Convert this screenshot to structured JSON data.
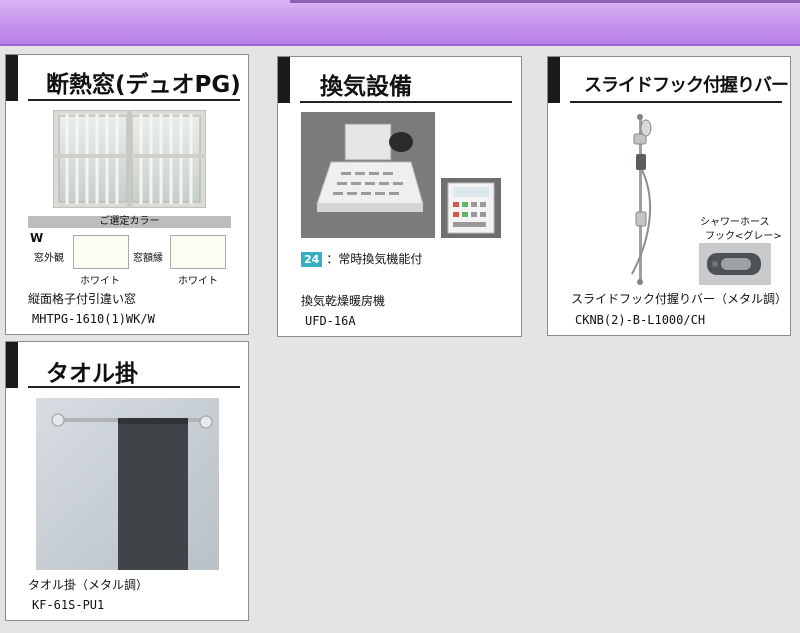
{
  "cards": {
    "window": {
      "title": "断熱窓(デュオPG)",
      "color_header": "ご選定カラー",
      "w_mark": "W",
      "outer_frame_label": "窓外観",
      "outer_frame_color": "ホワイト",
      "frame_label": "窓額縁",
      "frame_color": "ホワイト",
      "product_name": "縦面格子付引違い窓",
      "product_code": "MHTPG-1610(1)WK/W"
    },
    "ventilation": {
      "title": "換気設備",
      "feature_badge": "24",
      "feature_text": "：常時換気機能付",
      "product_name": "換気乾燥暖房機",
      "product_code": "UFD-16A"
    },
    "slide_bar": {
      "title": "スライドフック付握りバー",
      "hose_label_1": "シャワーホース",
      "hose_label_2": "フック<グレー>",
      "product_name": "スライドフック付握りバー（メタル調）",
      "product_code": "CKNB(2)-B-L1000/CH"
    },
    "towel": {
      "title": "タオル掛",
      "product_name": "タオル掛（メタル調）",
      "product_code": "KF-61S-PU1"
    }
  },
  "colors": {
    "header_band": "#c592ec",
    "badge": "#36b1c4",
    "swatch": "#fdfdf2"
  }
}
